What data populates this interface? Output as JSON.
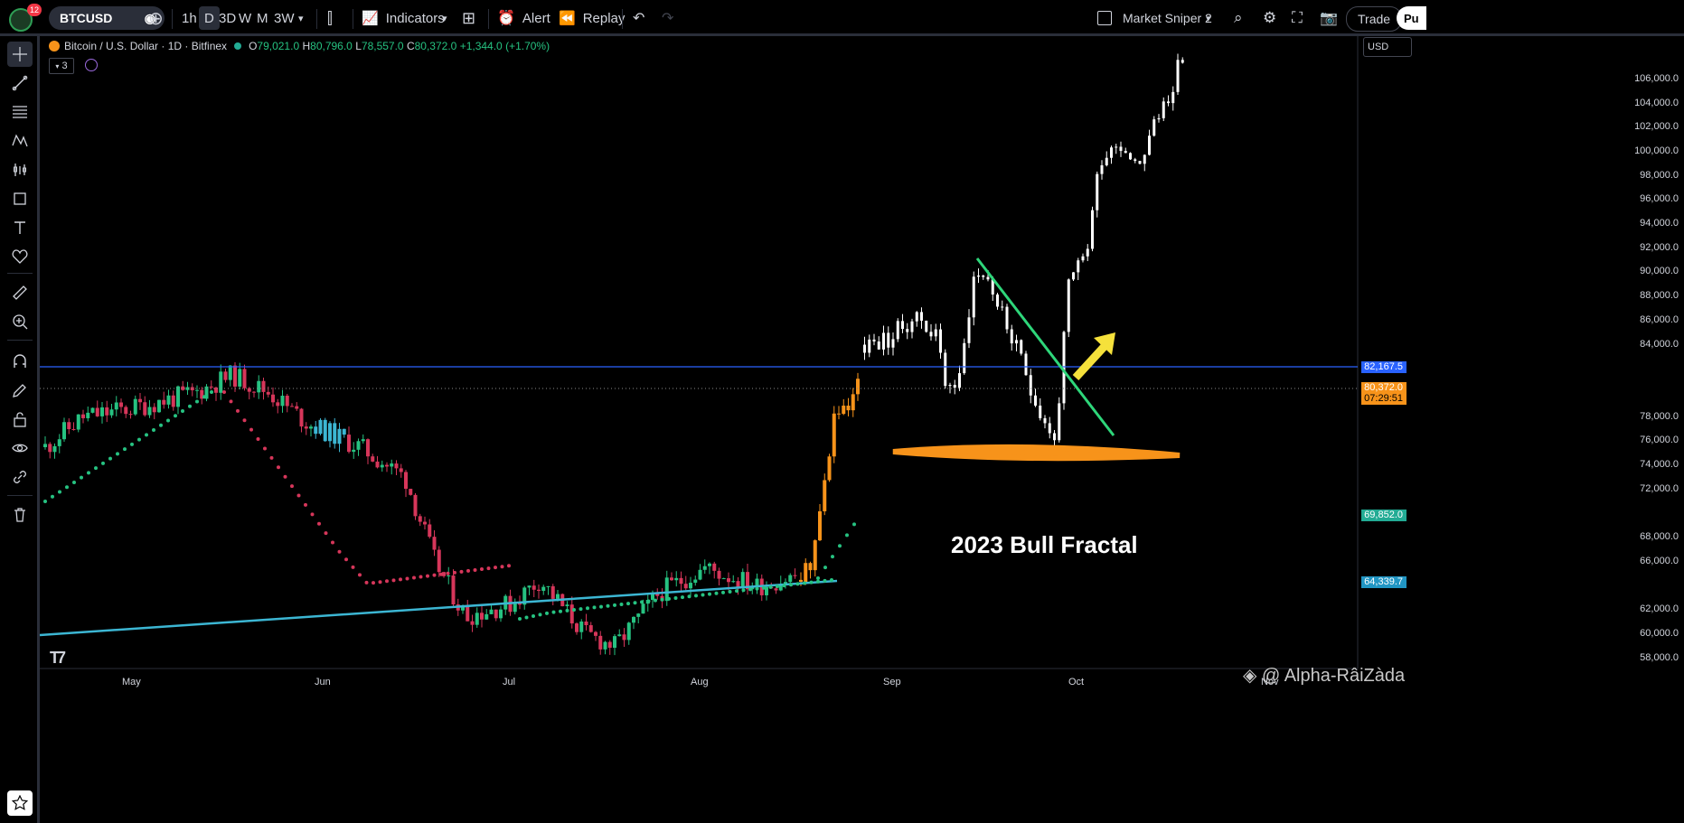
{
  "topbar": {
    "notification_count": "12",
    "symbol": "BTCUSD",
    "intervals": [
      "1h",
      "D",
      "3D",
      "W",
      "M",
      "3W"
    ],
    "indicators_label": "Indicators",
    "alert_label": "Alert",
    "replay_label": "Replay",
    "layout_name": "Market Sniper 2",
    "trade_label": "Trade",
    "publish_label": "Pu"
  },
  "legend": {
    "title": "Bitcoin / U.S. Dollar · 1D · Bitfinex",
    "open_key": "O",
    "open": "79,021.0",
    "high_key": "H",
    "high": "80,796.0",
    "low_key": "L",
    "low": "78,557.0",
    "close_key": "C",
    "close": "80,372.0",
    "change": "+1,344.0 (+1.70%)",
    "indicator_count": "3"
  },
  "price_scale": {
    "currency": "USD",
    "ticks": [
      "106,000.0",
      "104,000.0",
      "102,000.0",
      "100,000.0",
      "98,000.0",
      "96,000.0",
      "94,000.0",
      "92,000.0",
      "90,000.0",
      "88,000.0",
      "86,000.0",
      "84,000.0",
      "78,000.0",
      "76,000.0",
      "74,000.0",
      "72,000.0",
      "68,000.0",
      "66,000.0",
      "62,000.0",
      "60,000.0",
      "58,000.0"
    ],
    "labels": [
      {
        "text": "82,167.5",
        "color": "#2962ff"
      },
      {
        "text": "80,372.0",
        "color": "#f7931a"
      },
      {
        "text": "07:29:51",
        "color": "#f7931a"
      },
      {
        "text": "69,852.0",
        "color": "#22ab94"
      },
      {
        "text": "64,339.7",
        "color": "#2196c4"
      }
    ]
  },
  "time_scale": [
    "May",
    "Jun",
    "Jul",
    "Aug",
    "Sep",
    "Oct",
    "Nov"
  ],
  "annotation": "2023 Bull Fractal",
  "watermark": "@ Alpha-RâiZàda",
  "colors": {
    "up": "#26c281",
    "down": "#d6365a",
    "orange": "#f7931a",
    "cyan": "#3cb6d3",
    "horizontal_line": "#2962ff",
    "trendline": "#2ed67a",
    "arrow": "#f5e13b",
    "projection": "#ffffff"
  },
  "chart_data": {
    "type": "candlestick",
    "symbol": "BTCUSD",
    "timeframe": "1D",
    "ylim": [
      57000,
      108000
    ],
    "x_labels": [
      "May",
      "Jun",
      "Jul",
      "Aug",
      "Sep",
      "Oct",
      "Nov"
    ],
    "horizontal_level": 82167.5,
    "last_close": 80372.0,
    "annotations": [
      "2023 Bull Fractal"
    ],
    "series": [
      {
        "name": "main",
        "description_points": [
          {
            "month": "May",
            "price": 76500
          },
          {
            "month": "mid-May",
            "price": 81500
          },
          {
            "month": "Jun",
            "price": 61000
          },
          {
            "month": "Jul",
            "price": 58500
          },
          {
            "month": "Aug",
            "price": 64000
          },
          {
            "month": "late-Aug",
            "price": 78500
          }
        ]
      },
      {
        "name": "projection",
        "description_points": [
          {
            "month": "Sep",
            "price": 86500
          },
          {
            "month": "mid-Sep",
            "price": 80500
          },
          {
            "month": "late-Sep",
            "price": 90500
          },
          {
            "month": "end-Sep",
            "price": 75500
          },
          {
            "month": "Oct",
            "price": 100500
          },
          {
            "month": "end-Oct",
            "price": 107500
          }
        ]
      }
    ]
  }
}
